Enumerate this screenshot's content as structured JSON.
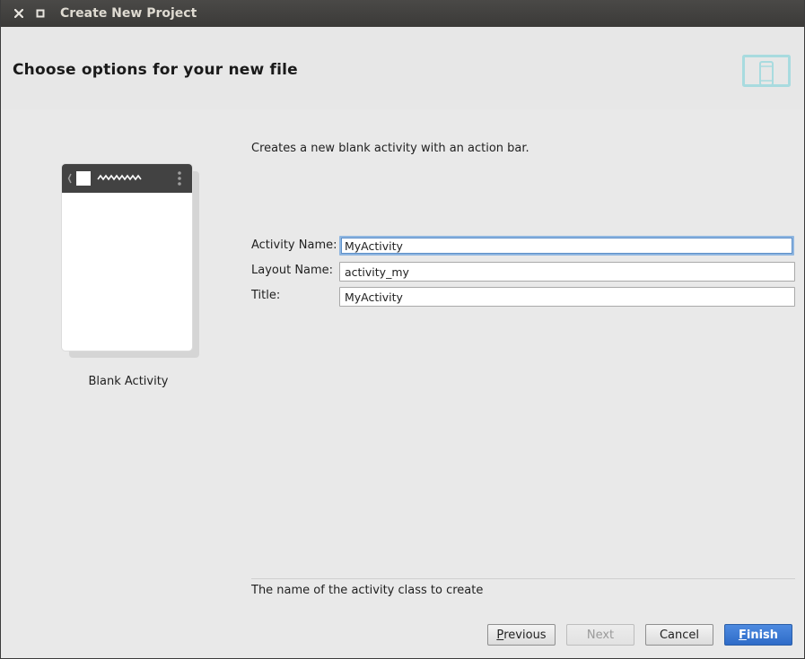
{
  "window": {
    "title": "Create New Project"
  },
  "header": {
    "heading": "Choose options for your new file",
    "icon": "device-icon"
  },
  "template": {
    "label": "Blank Activity"
  },
  "description": "Creates a new blank activity with an action bar.",
  "form": {
    "fields": [
      {
        "label": "Activity Name:",
        "value": "MyActivity"
      },
      {
        "label": "Layout Name:",
        "value": "activity_my"
      },
      {
        "label": "Title:",
        "value": "MyActivity"
      }
    ]
  },
  "help_text": "The name of the activity class to create",
  "buttons": {
    "previous": {
      "mnemonic": "P",
      "rest": "revious"
    },
    "next": "Next",
    "cancel": "Cancel",
    "finish": {
      "mnemonic": "F",
      "rest": "inish"
    }
  },
  "colors": {
    "accent": "#2f6cc8",
    "focus_ring": "#8fb6e0",
    "header_icon": "#a8dbdf",
    "titlebar": "#3b3a38"
  }
}
